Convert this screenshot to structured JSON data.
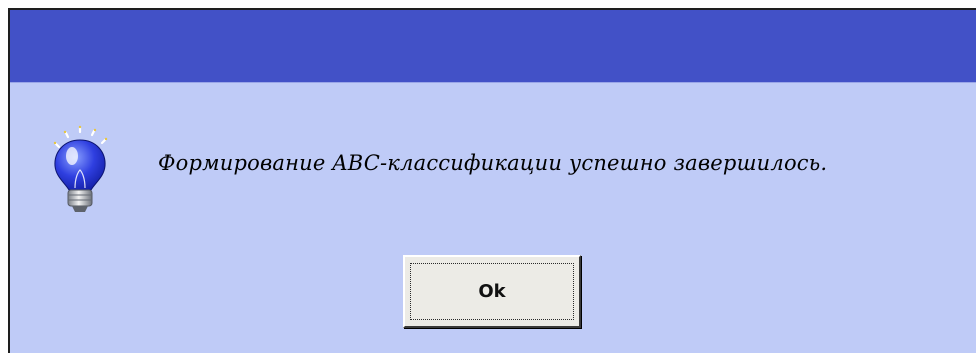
{
  "dialog": {
    "icon": "lightbulb-icon",
    "message": "Формирование ABC-классификации успешно завершилось.",
    "ok_label": "Ok",
    "colors": {
      "titlebar": "#4251c7",
      "background": "#bfcbf7",
      "button": "#ecebe6"
    }
  }
}
